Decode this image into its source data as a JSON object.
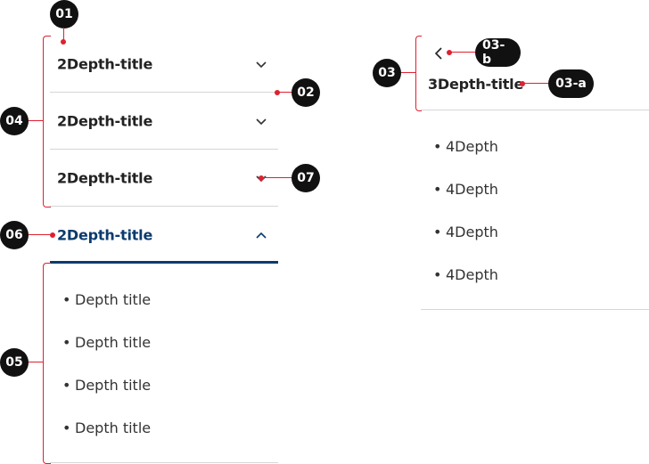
{
  "accordion": {
    "rows": [
      {
        "title": "2Depth-title"
      },
      {
        "title": "2Depth-title"
      },
      {
        "title": "2Depth-title"
      },
      {
        "title": "2Depth-title"
      }
    ],
    "sub_items": [
      "Depth title",
      "Depth title",
      "Depth title",
      "Depth title"
    ],
    "bullet": "•"
  },
  "panel": {
    "title": "3Depth-title",
    "items": [
      "4Depth",
      "4Depth",
      "4Depth",
      "4Depth"
    ]
  },
  "callouts": {
    "c01": "01",
    "c02": "02",
    "c03": "03",
    "c03a": "03-a",
    "c03b": "03-b",
    "c04": "04",
    "c05": "05",
    "c06": "06",
    "c07": "07"
  },
  "colors": {
    "accent": "#0b3a6e",
    "marker": "#e0202f",
    "divider": "#d6d6d6"
  }
}
